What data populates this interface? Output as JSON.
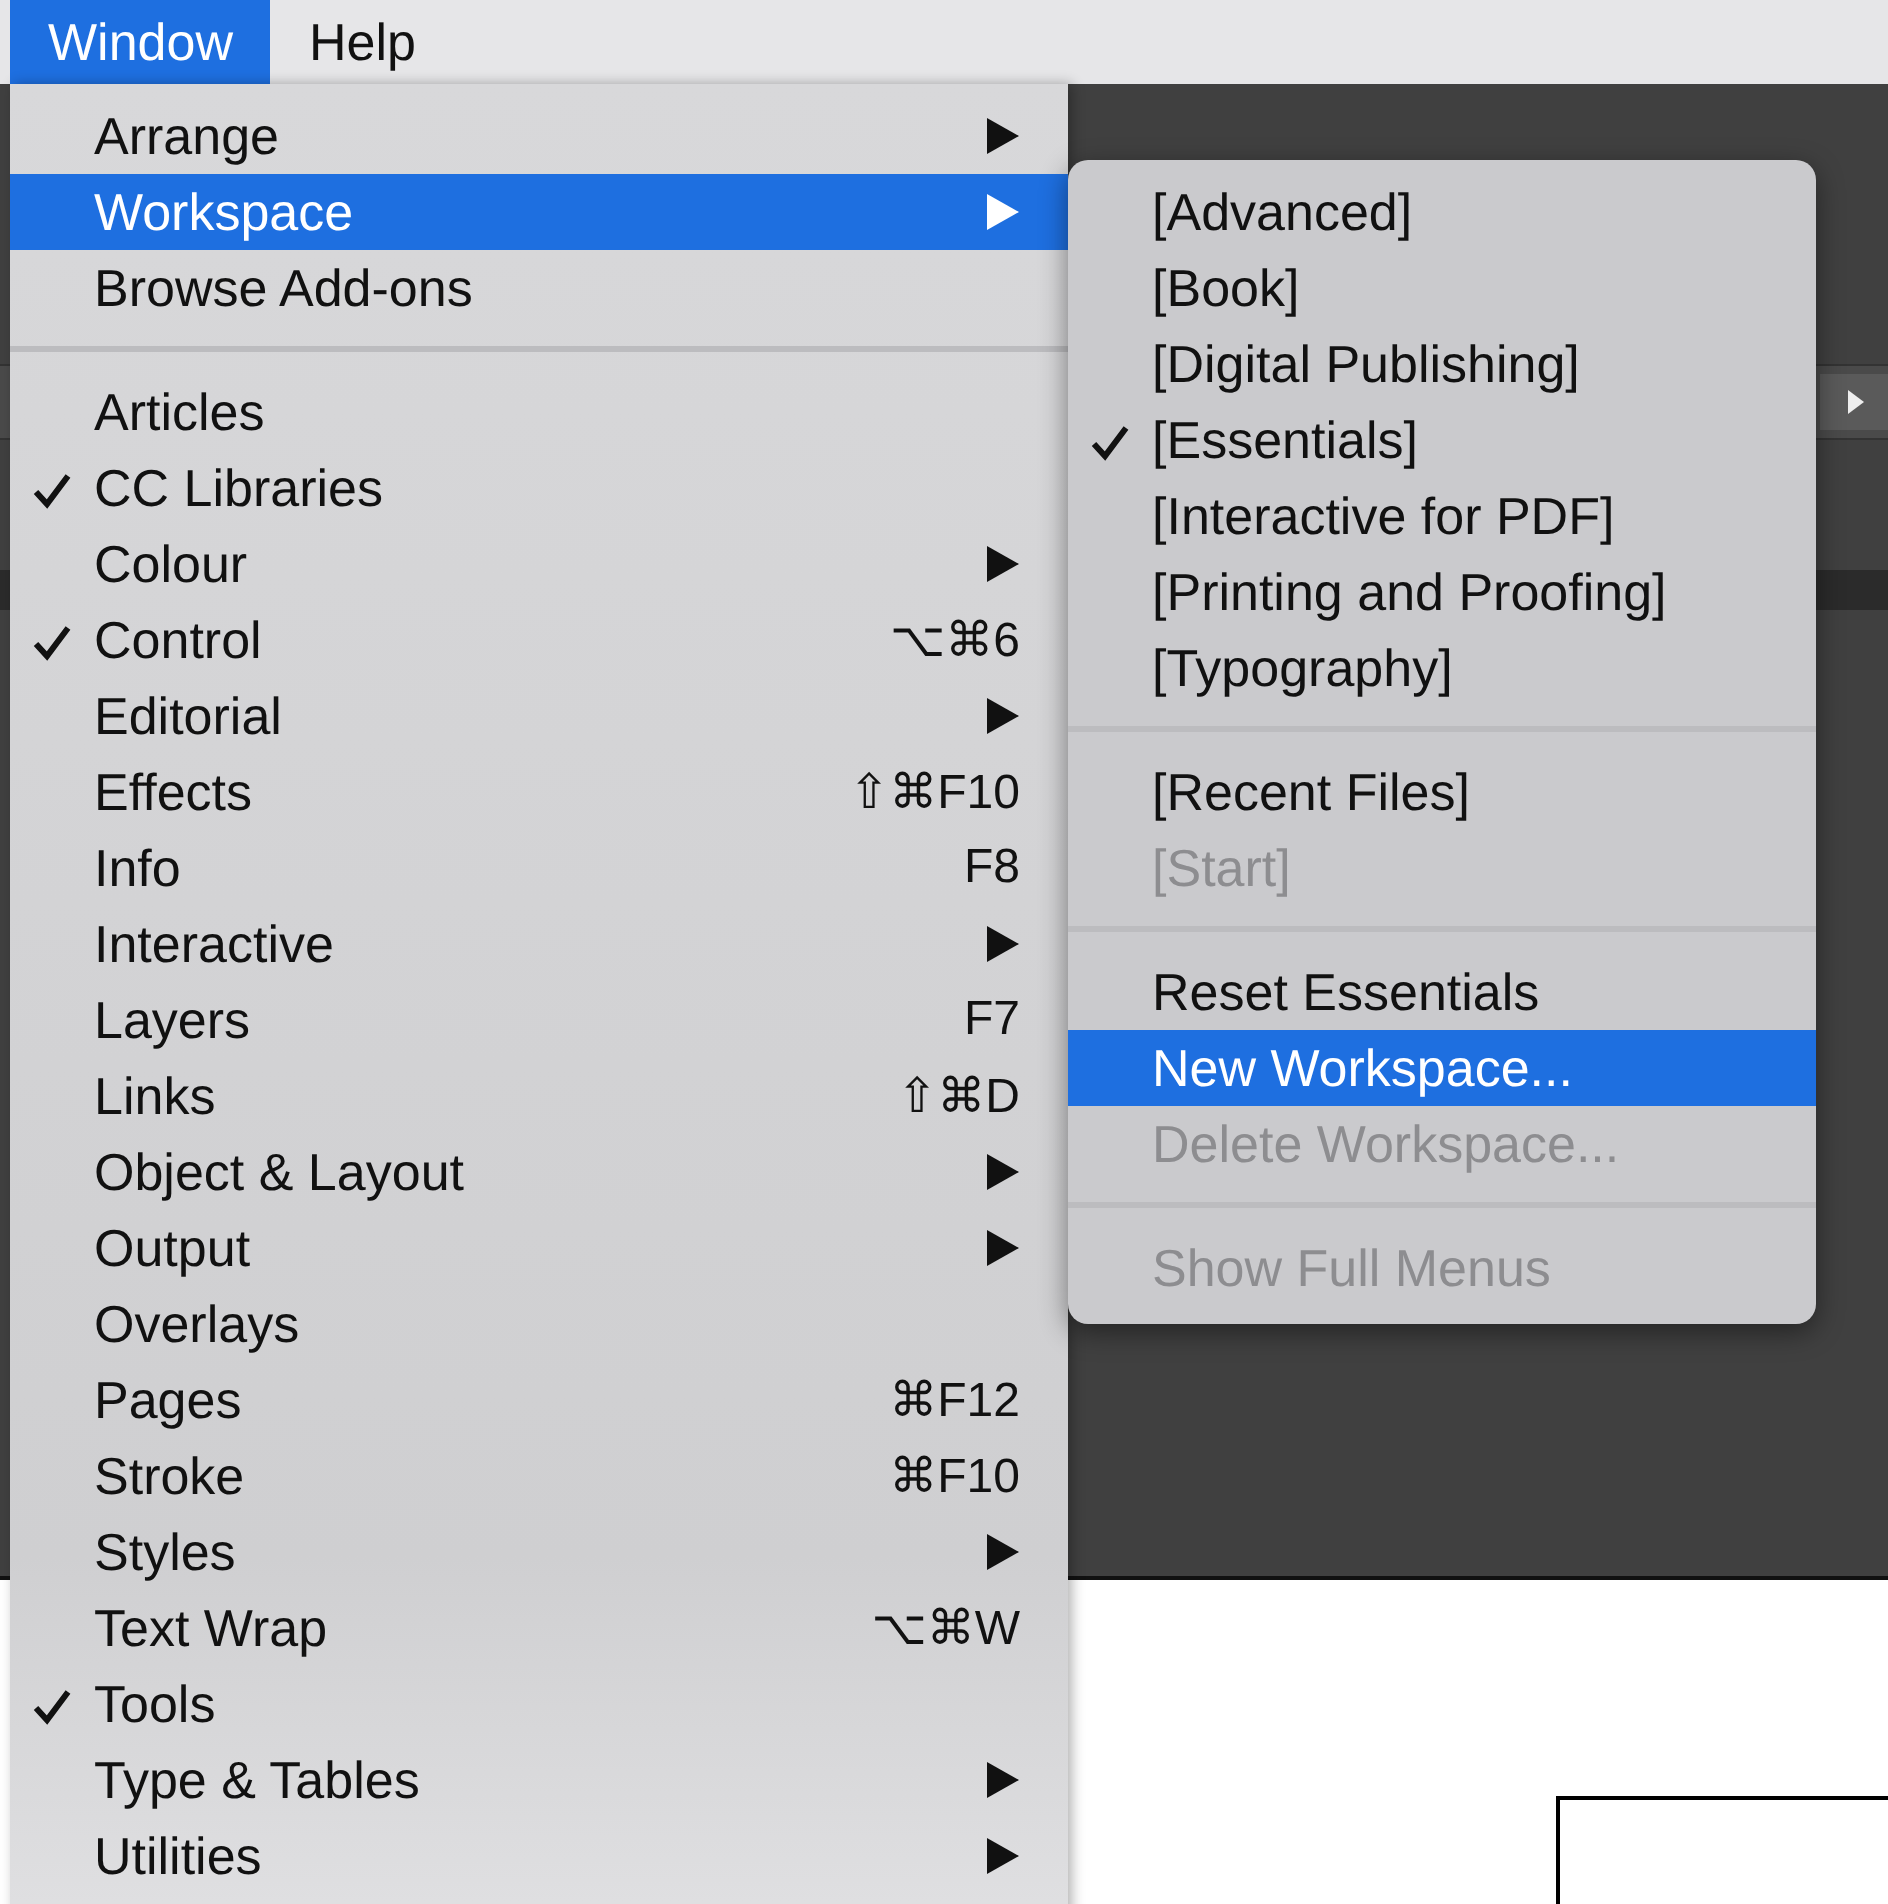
{
  "menubar": [
    {
      "label": "Window",
      "selected": true
    },
    {
      "label": "Help",
      "selected": false
    }
  ],
  "window_menu": [
    {
      "kind": "item",
      "label": "Arrange",
      "checked": false,
      "submenu": true,
      "selected": false
    },
    {
      "kind": "item",
      "label": "Workspace",
      "checked": false,
      "submenu": true,
      "selected": true
    },
    {
      "kind": "item",
      "label": "Browse Add-ons",
      "checked": false,
      "submenu": false,
      "selected": false
    },
    {
      "kind": "separator"
    },
    {
      "kind": "item",
      "label": "Articles",
      "checked": false,
      "submenu": false,
      "selected": false
    },
    {
      "kind": "item",
      "label": "CC Libraries",
      "checked": true,
      "submenu": false,
      "selected": false
    },
    {
      "kind": "item",
      "label": "Colour",
      "checked": false,
      "submenu": true,
      "selected": false
    },
    {
      "kind": "item",
      "label": "Control",
      "checked": true,
      "submenu": false,
      "selected": false,
      "shortcut": "⌥⌘6"
    },
    {
      "kind": "item",
      "label": "Editorial",
      "checked": false,
      "submenu": true,
      "selected": false
    },
    {
      "kind": "item",
      "label": "Effects",
      "checked": false,
      "submenu": false,
      "selected": false,
      "shortcut": "⇧⌘F10"
    },
    {
      "kind": "item",
      "label": "Info",
      "checked": false,
      "submenu": false,
      "selected": false,
      "shortcut": "F8"
    },
    {
      "kind": "item",
      "label": "Interactive",
      "checked": false,
      "submenu": true,
      "selected": false
    },
    {
      "kind": "item",
      "label": "Layers",
      "checked": false,
      "submenu": false,
      "selected": false,
      "shortcut": "F7"
    },
    {
      "kind": "item",
      "label": "Links",
      "checked": false,
      "submenu": false,
      "selected": false,
      "shortcut": "⇧⌘D"
    },
    {
      "kind": "item",
      "label": "Object & Layout",
      "checked": false,
      "submenu": true,
      "selected": false
    },
    {
      "kind": "item",
      "label": "Output",
      "checked": false,
      "submenu": true,
      "selected": false
    },
    {
      "kind": "item",
      "label": "Overlays",
      "checked": false,
      "submenu": false,
      "selected": false
    },
    {
      "kind": "item",
      "label": "Pages",
      "checked": false,
      "submenu": false,
      "selected": false,
      "shortcut": "⌘F12"
    },
    {
      "kind": "item",
      "label": "Stroke",
      "checked": false,
      "submenu": false,
      "selected": false,
      "shortcut": "⌘F10"
    },
    {
      "kind": "item",
      "label": "Styles",
      "checked": false,
      "submenu": true,
      "selected": false
    },
    {
      "kind": "item",
      "label": "Text Wrap",
      "checked": false,
      "submenu": false,
      "selected": false,
      "shortcut": "⌥⌘W"
    },
    {
      "kind": "item",
      "label": "Tools",
      "checked": true,
      "submenu": false,
      "selected": false
    },
    {
      "kind": "item",
      "label": "Type & Tables",
      "checked": false,
      "submenu": true,
      "selected": false
    },
    {
      "kind": "item",
      "label": "Utilities",
      "checked": false,
      "submenu": true,
      "selected": false
    }
  ],
  "workspace_submenu": [
    {
      "kind": "item",
      "label": "[Advanced]",
      "checked": false,
      "disabled": false,
      "selected": false
    },
    {
      "kind": "item",
      "label": "[Book]",
      "checked": false,
      "disabled": false,
      "selected": false
    },
    {
      "kind": "item",
      "label": "[Digital Publishing]",
      "checked": false,
      "disabled": false,
      "selected": false
    },
    {
      "kind": "item",
      "label": "[Essentials]",
      "checked": true,
      "disabled": false,
      "selected": false
    },
    {
      "kind": "item",
      "label": "[Interactive for PDF]",
      "checked": false,
      "disabled": false,
      "selected": false
    },
    {
      "kind": "item",
      "label": "[Printing and Proofing]",
      "checked": false,
      "disabled": false,
      "selected": false
    },
    {
      "kind": "item",
      "label": "[Typography]",
      "checked": false,
      "disabled": false,
      "selected": false
    },
    {
      "kind": "separator"
    },
    {
      "kind": "item",
      "label": "[Recent Files]",
      "checked": false,
      "disabled": false,
      "selected": false
    },
    {
      "kind": "item",
      "label": "[Start]",
      "checked": false,
      "disabled": true,
      "selected": false
    },
    {
      "kind": "separator"
    },
    {
      "kind": "item",
      "label": "Reset Essentials",
      "checked": false,
      "disabled": false,
      "selected": false
    },
    {
      "kind": "item",
      "label": "New Workspace...",
      "checked": false,
      "disabled": false,
      "selected": true
    },
    {
      "kind": "item",
      "label": "Delete Workspace...",
      "checked": false,
      "disabled": true,
      "selected": false
    },
    {
      "kind": "separator"
    },
    {
      "kind": "item",
      "label": "Show Full Menus",
      "checked": false,
      "disabled": true,
      "selected": false
    }
  ]
}
